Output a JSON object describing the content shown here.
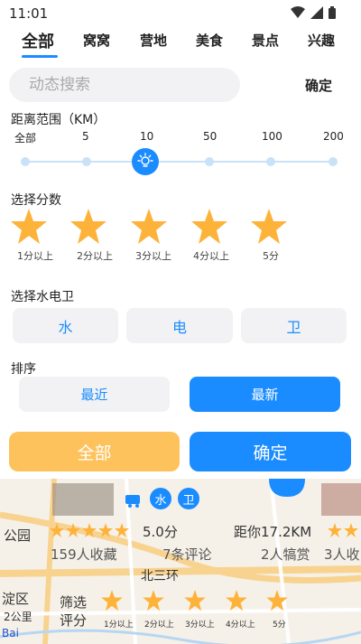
{
  "status_bar": {
    "time": "11:01"
  },
  "tabs": [
    {
      "label": "全部",
      "active": true
    },
    {
      "label": "窝窝"
    },
    {
      "label": "营地"
    },
    {
      "label": "美食"
    },
    {
      "label": "景点"
    },
    {
      "label": "兴趣"
    }
  ],
  "search": {
    "placeholder": "动态搜索",
    "value": "",
    "confirm_label": "确定"
  },
  "distance": {
    "title": "距离范围（KM）",
    "ticks": [
      "全部",
      "5",
      "10",
      "50",
      "100",
      "200"
    ],
    "selected": "10"
  },
  "score": {
    "title": "选择分数",
    "options": [
      "1分以上",
      "2分以上",
      "3分以上",
      "4分以上",
      "5分"
    ]
  },
  "utilities": {
    "title": "选择水电卫",
    "options": [
      "水",
      "电",
      "卫"
    ]
  },
  "sort": {
    "title": "排序",
    "options": [
      "最近",
      "最新"
    ],
    "selected": "最新"
  },
  "footer": {
    "all_label": "全部",
    "confirm_label": "确定"
  },
  "background_map": {
    "rating_text": "5.0分",
    "distance_text": "距你17.2KM",
    "collect_text": "159人收藏",
    "comment_text": "7条评论",
    "reward_text": "2人犒赏",
    "partial_collect_text": "3人收",
    "util_water": "水",
    "util_toilet": "卫",
    "road_label": "北三环",
    "left_label_1": "公园",
    "left_label_2": "淀区",
    "scale_text": "2公里",
    "filter_label_1": "筛选",
    "filter_label_2": "评分",
    "filter_stars": [
      "1分以上",
      "2分以上",
      "3分以上",
      "4分以上",
      "5分"
    ],
    "baidu_logo": "Bai"
  },
  "colors": {
    "accent": "#1a8cff",
    "star": "#fdb23a",
    "all_button": "#fdc25b",
    "pill_bg": "#f2f2f4"
  }
}
